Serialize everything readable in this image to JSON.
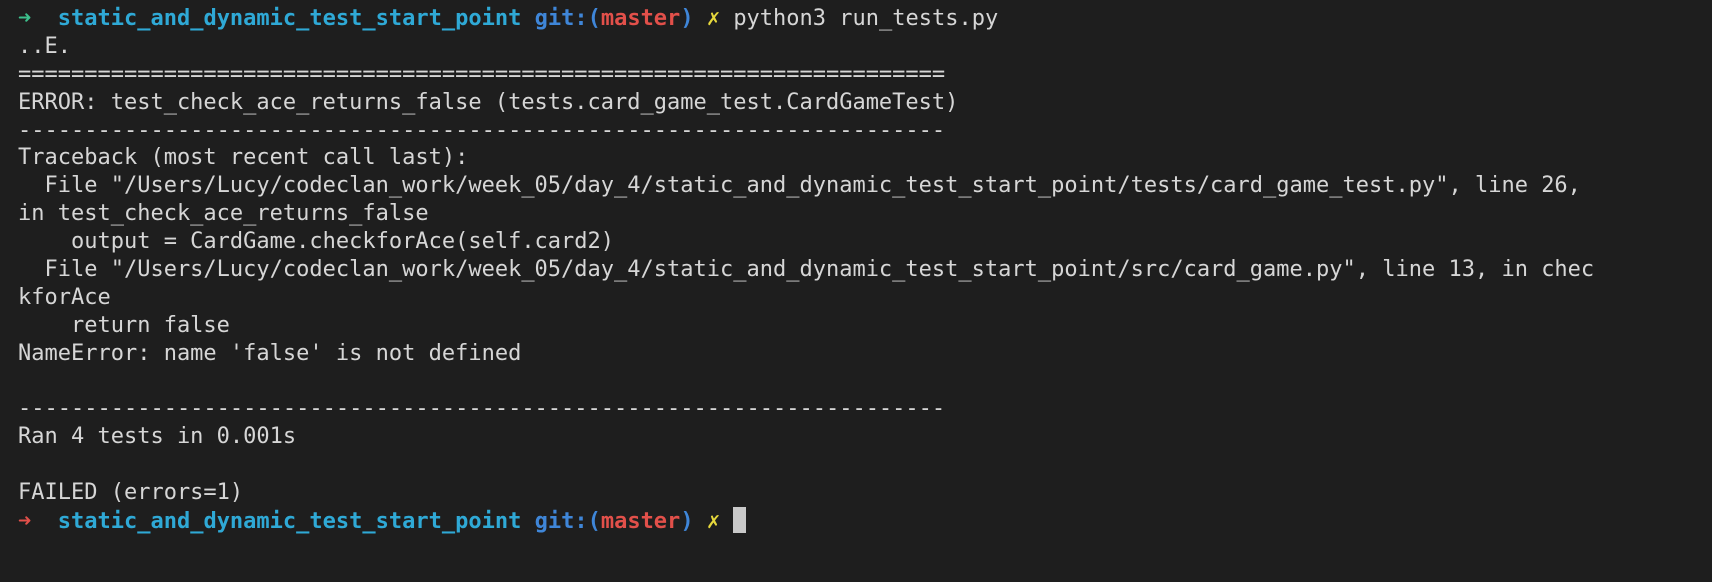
{
  "prompt": {
    "arrow": "➜",
    "directory": "static_and_dynamic_test_start_point",
    "git_label": "git:",
    "paren_open": "(",
    "branch": "master",
    "paren_close": ")",
    "dirty_marker": "✗"
  },
  "command": "python3 run_tests.py",
  "output": {
    "progress": "..E.",
    "separator_double": "======================================================================",
    "error_header": "ERROR: test_check_ace_returns_false (tests.card_game_test.CardGameTest)",
    "separator_single": "----------------------------------------------------------------------",
    "traceback_header": "Traceback (most recent call last):",
    "trace_lines": [
      "  File \"/Users/Lucy/codeclan_work/week_05/day_4/static_and_dynamic_test_start_point/tests/card_game_test.py\", line 26,",
      "in test_check_ace_returns_false",
      "    output = CardGame.checkforAce(self.card2)",
      "  File \"/Users/Lucy/codeclan_work/week_05/day_4/static_and_dynamic_test_start_point/src/card_game.py\", line 13, in chec",
      "kforAce",
      "    return false"
    ],
    "exception": "NameError: name 'false' is not defined",
    "summary": "Ran 4 tests in 0.001s",
    "result": "FAILED (errors=1)"
  },
  "colors": {
    "background": "#1e1e1e",
    "text": "#d6d6d6",
    "arrow_success": "#3cc08c",
    "arrow_failure": "#e2504a",
    "directory": "#2fa9d6",
    "git_label": "#3f86d8",
    "branch": "#e2504a",
    "dirty_marker": "#e6d83c"
  }
}
